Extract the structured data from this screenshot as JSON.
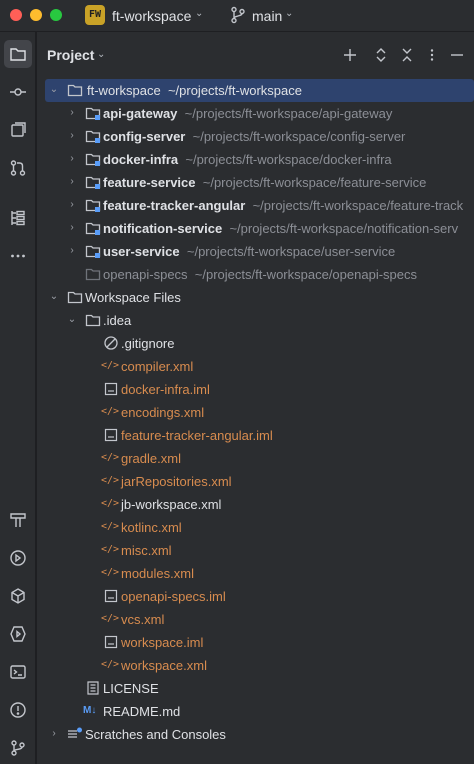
{
  "titlebar": {
    "project_badge": "FW",
    "project_name": "ft-workspace",
    "branch_name": "main"
  },
  "panel": {
    "title": "Project"
  },
  "tree": {
    "root": {
      "name": "ft-workspace",
      "path": "~/projects/ft-workspace"
    },
    "modules": [
      {
        "name": "api-gateway",
        "path": "~/projects/ft-workspace/api-gateway"
      },
      {
        "name": "config-server",
        "path": "~/projects/ft-workspace/config-server"
      },
      {
        "name": "docker-infra",
        "path": "~/projects/ft-workspace/docker-infra"
      },
      {
        "name": "feature-service",
        "path": "~/projects/ft-workspace/feature-service"
      },
      {
        "name": "feature-tracker-angular",
        "path": "~/projects/ft-workspace/feature-track"
      },
      {
        "name": "notification-service",
        "path": "~/projects/ft-workspace/notification-serv"
      },
      {
        "name": "user-service",
        "path": "~/projects/ft-workspace/user-service"
      }
    ],
    "excluded": {
      "name": "openapi-specs",
      "path": "~/projects/ft-workspace/openapi-specs"
    },
    "workspace_files": "Workspace Files",
    "idea_folder": ".idea",
    "idea_files": [
      ".gitignore",
      "compiler.xml",
      "docker-infra.iml",
      "encodings.xml",
      "feature-tracker-angular.iml",
      "gradle.xml",
      "jarRepositories.xml",
      "jb-workspace.xml",
      "kotlinc.xml",
      "misc.xml",
      "modules.xml",
      "openapi-specs.iml",
      "vcs.xml",
      "workspace.iml",
      "workspace.xml"
    ],
    "license": "LICENSE",
    "readme": "README.md",
    "scratches": "Scratches and Consoles"
  },
  "colors": {
    "background": "#2b2d30",
    "selection": "#2e436e",
    "modified_file": "#d88c4f",
    "path_gray": "#8c8f96"
  }
}
